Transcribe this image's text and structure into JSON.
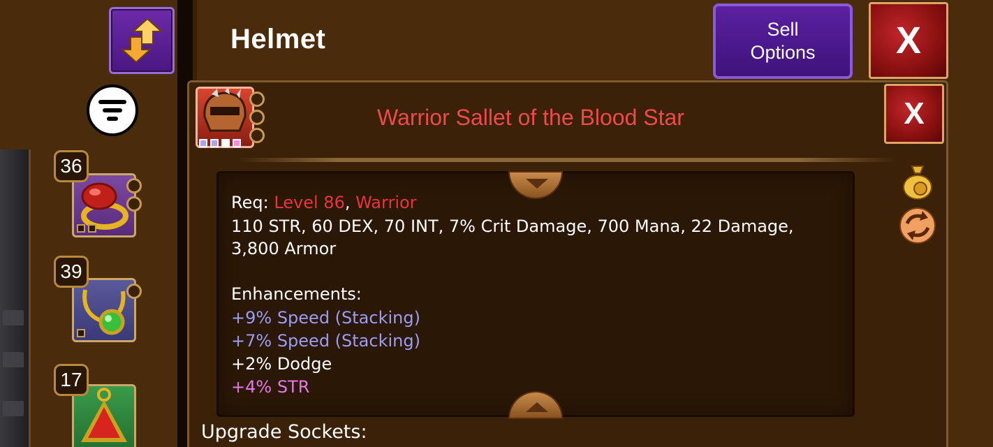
{
  "header": {
    "title": "Helmet",
    "sell_options_label": "Sell\nOptions",
    "close_label": "X"
  },
  "inventory": {
    "slots": [
      {
        "level": "36",
        "name": "ruby ring"
      },
      {
        "level": "39",
        "name": "emerald amulet"
      },
      {
        "level": "17",
        "name": "ruby pendant"
      }
    ]
  },
  "item": {
    "title": "Warrior Sallet of the Blood Star",
    "close_label": "X",
    "req_label": "Req: ",
    "req_level": "Level 86",
    "req_sep": ", ",
    "req_class": "Warrior",
    "stats_line1": "110 STR, 60 DEX, 70 INT, 7% Crit Damage, 700 Mana, 22 Damage,",
    "stats_line2": "3,800 Armor",
    "enhancements_label": "Enhancements:",
    "enhancements": [
      {
        "text": "+9% Speed (Stacking)",
        "color": "#9b9df0"
      },
      {
        "text": "+7% Speed (Stacking)",
        "color": "#9b9df0"
      },
      {
        "text": "+2% Dodge",
        "color": "#ffffff"
      },
      {
        "text": "+4% STR",
        "color": "#e279e6"
      }
    ],
    "upgrade_sockets_label": "Upgrade Sockets:"
  },
  "icons": {
    "sort": "sort-swap-icon",
    "filter": "filter-icon",
    "sell": "money-bag-icon",
    "swap": "swap-cycle-icon"
  },
  "colors": {
    "background": "#4a2c0c",
    "title_red": "#ee4a4a",
    "requirement_red": "#e8343a",
    "speed_blue": "#9b9df0",
    "str_pink": "#e279e6",
    "button_purple": "#5a20a0"
  }
}
